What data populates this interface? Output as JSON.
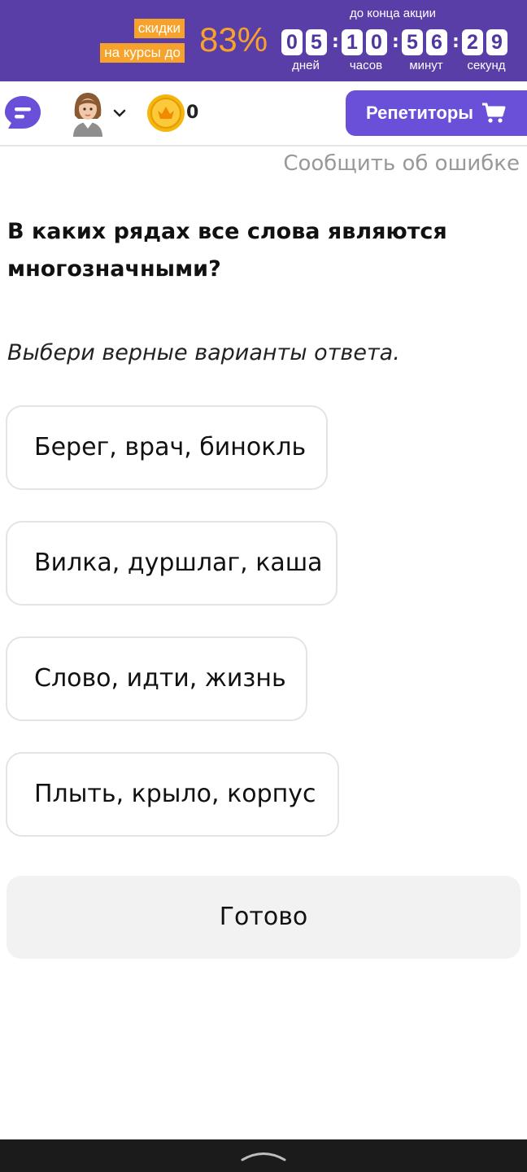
{
  "promo": {
    "tag_line1": "скидки",
    "tag_line2": "на курсы до",
    "percent": "83%",
    "until_label": "до конца акции",
    "days": [
      "0",
      "5"
    ],
    "hours": [
      "1",
      "0"
    ],
    "minutes": [
      "5",
      "6"
    ],
    "seconds": [
      "2",
      "9"
    ],
    "unit_days": "дней",
    "unit_hours": "часов",
    "unit_minutes": "минут",
    "unit_seconds": "секунд",
    "colors": {
      "background": "#5a3ea8",
      "accent": "#f7a22b"
    }
  },
  "header": {
    "chat_icon": "chat-bubble-icon",
    "avatar_icon": "avatar-girl-icon",
    "coin_count": "0",
    "tutors_label": "Репетиторы",
    "tutors_icon": "cart-icon",
    "accent_color": "#6a4fd8"
  },
  "report_error": "Сообщить об ошибке",
  "question": "В каких рядах все слова являются многозначными?",
  "instruction": "Выбери верные варианты ответа.",
  "options": [
    "Берег, врач, бинокль",
    "Вилка, дуршлаг, каша",
    "Слово, идти, жизнь",
    "Плыть, крыло, корпус"
  ],
  "done_label": "Готово"
}
